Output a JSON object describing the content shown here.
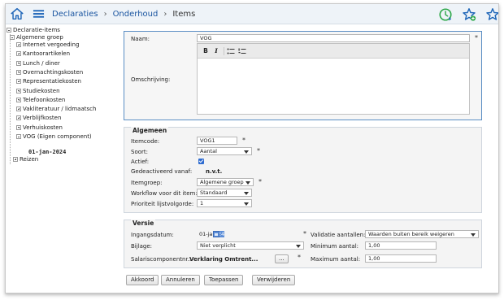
{
  "breadcrumb": {
    "items": [
      "Declaraties",
      "Onderhoud",
      "Items"
    ],
    "separator": "›"
  },
  "toolbar_icons": [
    "home-icon",
    "menu-icon",
    "refresh-clock-icon",
    "star-add-icon",
    "star-outline-icon"
  ],
  "colors": {
    "accent": "#1a55a0",
    "icon_green": "#2ea84a",
    "icon_blue": "#1f66b8",
    "panel_border": "#5b8ec4"
  },
  "tree": {
    "root": "Declaratie-items",
    "group": "Algemene groep",
    "children": [
      "Internet vergoeding",
      "Kantoorartikelen",
      "Lunch / diner",
      "Overnachtingskosten",
      "Representatiekosten",
      "Studiekosten",
      "Telefoonkosten",
      "Vakliteratuur / lidmaatsch",
      "Verblijfkosten",
      "Verhuiskosten",
      "VOG (Eigen component)"
    ],
    "selected": "01-jan-2024",
    "other": "Reizen"
  },
  "form": {
    "naam_label": "Naam:",
    "naam_value": "VOG",
    "omschrijving_label": "Omschrijving:",
    "editor_tools": [
      "B",
      "I",
      "bulleted-list-icon",
      "numbered-list-icon"
    ],
    "required_marker": "*"
  },
  "algemeen": {
    "legend": "Algemeen",
    "itemcode_label": "Itemcode:",
    "itemcode_value": "VOG1",
    "soort_label": "Soort:",
    "soort_value": "Aantal",
    "actief_label": "Actief:",
    "actief_checked": true,
    "gedeactiveerd_label": "Gedeactiveerd vanaf:",
    "gedeactiveerd_value": "n.v.t.",
    "itemgroep_label": "Itemgroep:",
    "itemgroep_value": "Algemene groep",
    "workflow_label": "Workflow voor dit item:",
    "workflow_value": "Standaard",
    "prioriteit_label": "Prioriteit lijstvolgorde:",
    "prioriteit_value": "1"
  },
  "versie": {
    "legend": "Versie",
    "ingangsdatum_label": "Ingangsdatum:",
    "ingangsdatum_value": "01-jan-",
    "ingangsdatum_year_highlight": "24",
    "validatie_label": "Validatie aantallen:",
    "validatie_value": "Waarden buiten bereik weigeren",
    "bijlage_label": "Bijlage:",
    "bijlage_value": "Niet verplicht",
    "minimum_label": "Minimum aantal:",
    "minimum_value": "1,00",
    "salaris_label": "Salariscomponentnr.:",
    "salaris_value": "Verklaring Omtrent...",
    "salaris_button": "...",
    "maximum_label": "Maximum aantal:",
    "maximum_value": "1,00"
  },
  "buttons": {
    "akkoord": "Akkoord",
    "annuleren": "Annuleren",
    "toepassen": "Toepassen",
    "verwijderen": "Verwijderen"
  }
}
